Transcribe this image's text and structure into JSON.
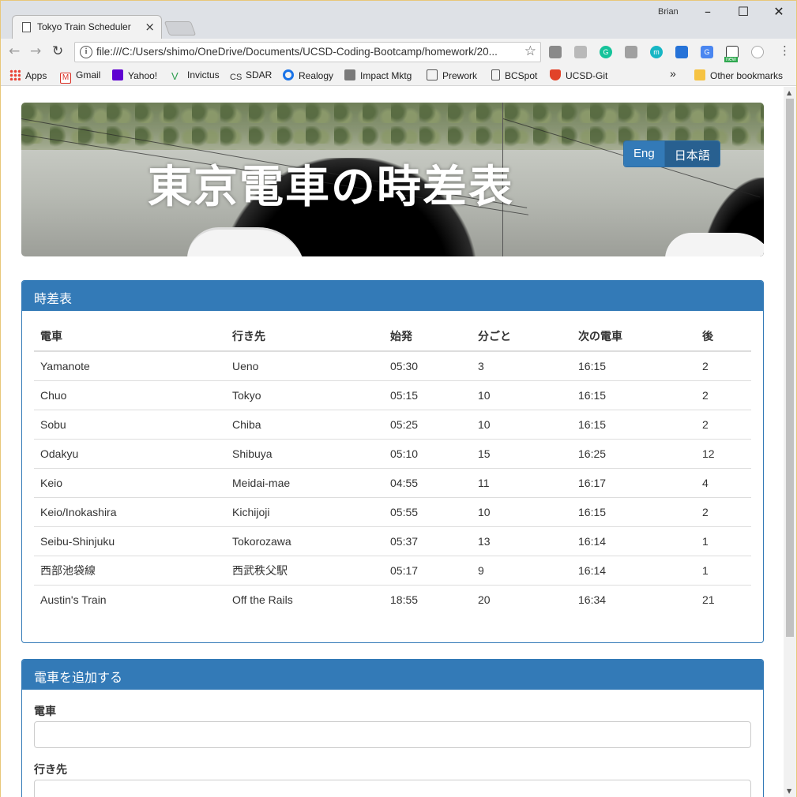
{
  "browser": {
    "tab_title": "Tokyo Train Scheduler",
    "profile_name": "Brian",
    "url": "file:///C:/Users/shimo/OneDrive/Documents/UCSD-Coding-Bootcamp/homework/20...",
    "bookmarks": [
      "Apps",
      "Gmail",
      "Yahoo!",
      "Invictus",
      "SDAR",
      "Realogy",
      "Impact Mktg",
      "Prework",
      "BCSpot",
      "UCSD-Git"
    ],
    "bookmarks_overflow": "»",
    "other_bookmarks": "Other bookmarks",
    "ext_new_badge": "new"
  },
  "hero": {
    "title": "東京電車の時差表",
    "lang_english": "Eng",
    "lang_japanese": "日本語"
  },
  "schedule": {
    "heading": "時差表",
    "columns": [
      "電車",
      "行き先",
      "始発",
      "分ごと",
      "次の電車",
      "後"
    ],
    "rows": [
      [
        "Yamanote",
        "Ueno",
        "05:30",
        "3",
        "16:15",
        "2"
      ],
      [
        "Chuo",
        "Tokyo",
        "05:15",
        "10",
        "16:15",
        "2"
      ],
      [
        "Sobu",
        "Chiba",
        "05:25",
        "10",
        "16:15",
        "2"
      ],
      [
        "Odakyu",
        "Shibuya",
        "05:10",
        "15",
        "16:25",
        "12"
      ],
      [
        "Keio",
        "Meidai-mae",
        "04:55",
        "11",
        "16:17",
        "4"
      ],
      [
        "Keio/Inokashira",
        "Kichijoji",
        "05:55",
        "10",
        "16:15",
        "2"
      ],
      [
        "Seibu-Shinjuku",
        "Tokorozawa",
        "05:37",
        "13",
        "16:14",
        "1"
      ],
      [
        "西部池袋線",
        "西武秩父駅",
        "05:17",
        "9",
        "16:14",
        "1"
      ],
      [
        "Austin's Train",
        "Off the Rails",
        "18:55",
        "20",
        "16:34",
        "21"
      ]
    ]
  },
  "add_train": {
    "heading": "電車を追加する",
    "train_label": "電車",
    "destination_label": "行き先",
    "train_value": "",
    "destination_value": ""
  },
  "colors": {
    "primary": "#337ab7",
    "primary_dark": "#286090"
  }
}
